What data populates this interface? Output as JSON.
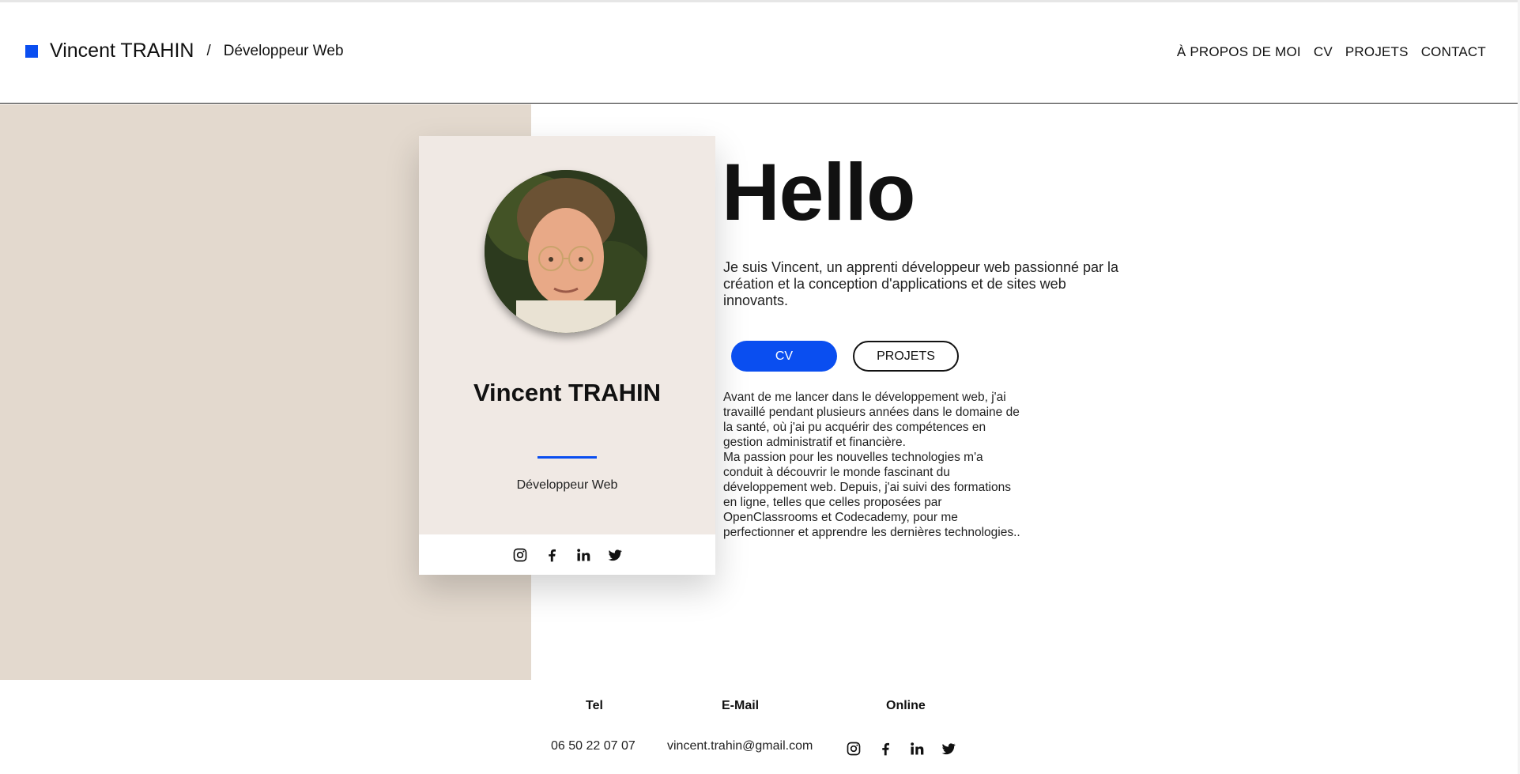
{
  "header": {
    "brand_name": "Vincent TRAHIN",
    "separator": "/",
    "brand_role": "Développeur Web",
    "accent_color": "#0a4ef0"
  },
  "nav": {
    "items": [
      "À PROPOS DE MOI",
      "CV",
      "PROJETS",
      "CONTACT"
    ]
  },
  "card": {
    "name": "Vincent TRAHIN",
    "role": "Développeur Web",
    "social_icons": [
      "instagram-icon",
      "facebook-icon",
      "linkedin-icon",
      "twitter-icon"
    ]
  },
  "hero": {
    "title": "Hello",
    "intro": "Je suis Vincent, un apprenti développeur web passionné par la création et la conception d'applications et de sites web innovants.",
    "buttons": {
      "cv": "CV",
      "projets": "PROJETS"
    },
    "bio_1": "Avant de me lancer dans le développement web, j'ai travaillé pendant plusieurs années dans le domaine de la santé, où j'ai pu acquérir des compétences en gestion administratif et financière.",
    "bio_2": "Ma passion pour les nouvelles technologies m'a conduit à découvrir le monde fascinant du développement web. Depuis, j'ai suivi des formations en ligne, telles que celles proposées par OpenClassrooms et Codecademy, pour me perfectionner et apprendre les dernières technologies.."
  },
  "footer": {
    "tel_label": "Tel",
    "tel_value": "06 50 22 07 07",
    "email_label": "E-Mail",
    "email_value": "vincent.trahin@gmail.com",
    "online_label": "Online"
  },
  "colors": {
    "beige_panel": "#e3d9ce",
    "card_bg": "#f0e9e4",
    "primary_button": "#0a4ef0"
  }
}
